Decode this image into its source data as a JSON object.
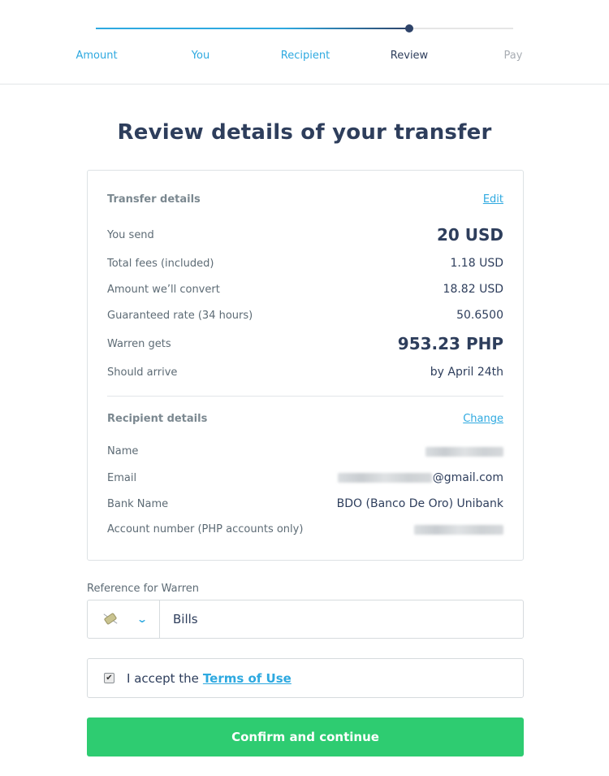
{
  "stepper": {
    "progress": 0.75,
    "steps": [
      {
        "label": "Amount",
        "state": "done"
      },
      {
        "label": "You",
        "state": "done"
      },
      {
        "label": "Recipient",
        "state": "done"
      },
      {
        "label": "Review",
        "state": "current"
      },
      {
        "label": "Pay",
        "state": "todo"
      }
    ]
  },
  "page_title": "Review details of your transfer",
  "transfer": {
    "heading": "Transfer details",
    "edit_label": "Edit",
    "rows": [
      {
        "label": "You send",
        "value": "20 USD"
      },
      {
        "label": "Total fees (included)",
        "value": "1.18 USD"
      },
      {
        "label": "Amount we’ll convert",
        "value": "18.82 USD"
      },
      {
        "label": "Guaranteed rate (34 hours)",
        "value": "50.6500"
      },
      {
        "label": "Warren gets",
        "value": "953.23 PHP"
      },
      {
        "label": "Should arrive",
        "value": "by April 24th"
      }
    ]
  },
  "recipient": {
    "heading": "Recipient details",
    "change_label": "Change",
    "rows": [
      {
        "label": "Name",
        "value": "[redacted]"
      },
      {
        "label": "Email",
        "value": "@gmail.com"
      },
      {
        "label": "Bank Name",
        "value": "BDO (Banco De Oro) Unibank"
      },
      {
        "label": "Account number (PHP accounts only)",
        "value": "[redacted]"
      }
    ]
  },
  "reference": {
    "label": "Reference for Warren",
    "category_icon": "money-with-wings-icon",
    "value": "Bills"
  },
  "terms": {
    "prefix": "I accept the",
    "link_label": "Terms of Use",
    "checked": true
  },
  "confirm_label": "Confirm and continue",
  "colors": {
    "accent": "#2ea9e0",
    "navy": "#2e3e5c",
    "confirm": "#2ecc71"
  }
}
